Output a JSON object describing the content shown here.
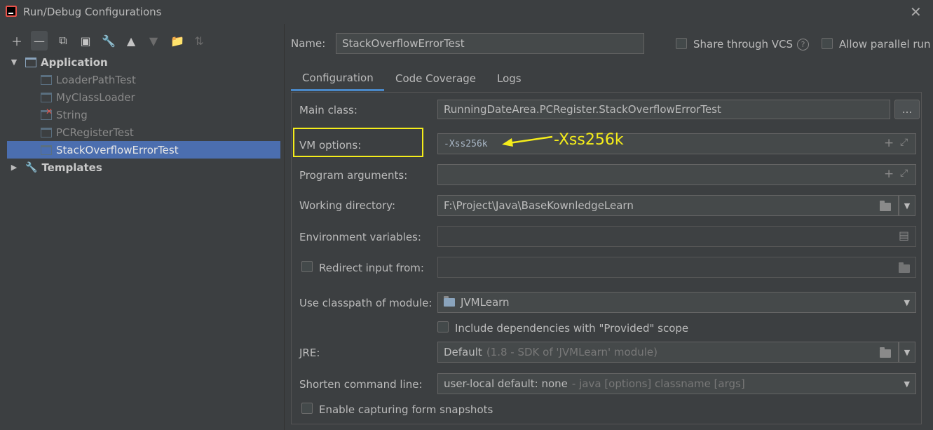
{
  "window": {
    "title": "Run/Debug Configurations"
  },
  "toolbar": {
    "buttons": [
      "add-icon",
      "remove-icon",
      "copy-icon",
      "save-icon",
      "wrench-icon",
      "move-up-icon",
      "move-down-icon",
      "new-folder-icon",
      "sort-icon"
    ]
  },
  "tree": {
    "application": "Application",
    "configs": [
      "LoaderPathTest",
      "MyClassLoader",
      "String",
      "PCRegisterTest",
      "StackOverflowErrorTest"
    ],
    "selected": "StackOverflowErrorTest",
    "templates": "Templates"
  },
  "header": {
    "name_label": "Name:",
    "name_value": "StackOverflowErrorTest",
    "share_vcs": "Share through VCS",
    "allow_parallel": "Allow parallel run"
  },
  "tabs": [
    "Configuration",
    "Code Coverage",
    "Logs"
  ],
  "form": {
    "main_class_label": "Main class:",
    "main_class_value": "RunningDateArea.PCRegister.StackOverflowErrorTest",
    "browse": "...",
    "vm_options_label": "VM options:",
    "vm_options_value": "-Xss256k",
    "program_args_label": "Program arguments:",
    "working_dir_label": "Working directory:",
    "working_dir_value": "F:\\Project\\Java\\BaseKownledgeLearn",
    "env_vars_label": "Environment variables:",
    "redirect_label": "Redirect input from:",
    "classpath_label": "Use classpath of module:",
    "classpath_value": "JVMLearn",
    "include_deps": "Include dependencies with \"Provided\" scope",
    "jre_label": "JRE:",
    "jre_value": "Default",
    "jre_hint": "(1.8 - SDK of 'JVMLearn' module)",
    "shorten_label": "Shorten command line:",
    "shorten_value": "user-local default: none",
    "shorten_hint": "- java [options] classname [args]",
    "capture_snapshots": "Enable capturing form snapshots"
  },
  "annotation": {
    "text": "-Xss256k",
    "color": "#f5ed1a"
  },
  "colors": {
    "accent": "#4a88c7",
    "selection": "#4b6eaf",
    "background": "#3c3f41"
  }
}
